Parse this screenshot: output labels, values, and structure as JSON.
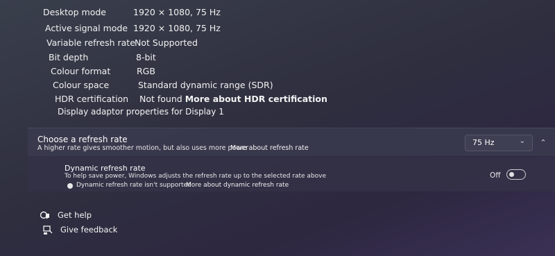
{
  "specs": [
    {
      "label": "Desktop mode",
      "value": "1920 × 1080, 75 Hz"
    },
    {
      "label": "Active signal mode",
      "value": "1920 × 1080, 75 Hz"
    },
    {
      "label": "Variable refresh rate",
      "value": "Not Supported"
    },
    {
      "label": "Bit depth",
      "value": "8-bit"
    },
    {
      "label": "Colour format",
      "value": "RGB"
    },
    {
      "label": "Colour space",
      "value": "Standard dynamic range (SDR)"
    },
    {
      "label": "HDR certification",
      "value": "Not found",
      "link": "More about HDR certification"
    }
  ],
  "adapter_link": "Display adaptor properties for Display 1",
  "refresh": {
    "title": "Choose a refresh rate",
    "description": "A higher rate gives smoother motion, but also uses more power",
    "link": "More about refresh rate",
    "selected": "75 Hz"
  },
  "dynamic": {
    "title": "Dynamic refresh rate",
    "description": "To help save power, Windows adjusts the refresh rate up to the selected rate above",
    "warning": "Dynamic refresh rate isn't supported",
    "link": "More about dynamic refresh rate",
    "toggle_state": "Off"
  },
  "help": {
    "get_help": "Get help",
    "feedback": "Give feedback"
  }
}
